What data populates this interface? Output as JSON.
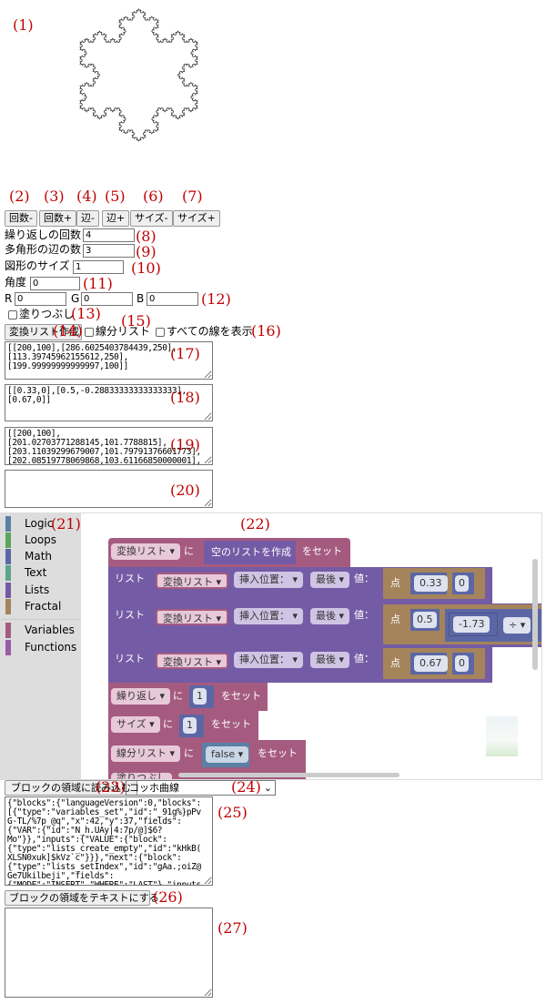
{
  "annotations": [
    "(1)",
    "(2)",
    "(3)",
    "(4)",
    "(5)",
    "(6)",
    "(7)",
    "(8)",
    "(9)",
    "(10)",
    "(11)",
    "(12)",
    "(13)",
    "(14)",
    "(15)",
    "(16)",
    "(17)",
    "(18)",
    "(19)",
    "(20)",
    "(21)",
    "(22)",
    "(23)",
    "(24)",
    "(25)",
    "(26)",
    "(27)"
  ],
  "fractal": {
    "type": "koch-snowflake",
    "stroke": "#333333",
    "iterations": 4,
    "sides": 3
  },
  "buttons": {
    "count_minus": "回数-",
    "count_plus": "回数+",
    "side_minus": "辺-",
    "side_plus": "辺+",
    "size_minus": "サイズ-",
    "size_plus": "サイズ+",
    "make_list": "変換リスト作成",
    "load_blocks": "ブロックの領域に読み込む",
    "blocks_to_text": "ブロックの領域をテキストにする"
  },
  "fields": {
    "repeat_label": "繰り返しの回数",
    "repeat_value": "4",
    "sides_label": "多角形の辺の数",
    "sides_value": "3",
    "size_label": "図形のサイズ",
    "size_value": "1",
    "angle_label": "角度",
    "angle_value": "0",
    "r_label": "R",
    "r_value": "0",
    "g_label": "G",
    "g_value": "0",
    "b_label": "B",
    "b_value": "0",
    "fill_label": "塗りつぶし",
    "segment_label": "線分リスト",
    "show_all_label": "すべての線を表示"
  },
  "textareas": {
    "t17": "[[200,100],[286.6025403784439,250],\n[113.39745962155612,250],\n[199.99999999999997,100]]",
    "t18": "[[0.33,0],[0.5,-0.28833333333333333],\n[0.67,0]]",
    "t19": "[[200,100],\n[201.02703771288145,101.7788815],\n[203.11039299679007,101.79791376601773],\n[202.08519778069868,103.61166850000001],\n[204.16855306460727,103.63069...]",
    "t20": "",
    "t25": "{\"blocks\":{\"languageVersion\":0,\"blocks\":\n[{\"type\":\"variables_set\",\"id\":\"_91g%}pPv\nG-TL/%7p_@q\",\"x\":42,\"y\":37,\"fields\":\n{\"VAR\":{\"id\":\"N_h.UAy|4:7p/@]$6?\nMo\"}},\"inputs\":{\"VALUE\":{\"block\":\n{\"type\":\"lists_create_empty\",\"id\":\"kHkB(\nXLSN0xuk]$kVz`c\"}}},\"next\":{\"block\":\n{\"type\":\"lists_setIndex\",\"id\":\"gAa.;oiZ@\nGe7Ukilbeji\",\"fields\":\n{\"MODE\":\"INSERT\",\"WHERE\":\"LAST\"},\"inputs",
    "t27": ""
  },
  "select": {
    "value": "コッホ曲線"
  },
  "toolbox": [
    {
      "label": "Logic",
      "color": "#5b80a5"
    },
    {
      "label": "Loops",
      "color": "#5ba55b"
    },
    {
      "label": "Math",
      "color": "#5b67a5"
    },
    {
      "label": "Text",
      "color": "#5ba58c"
    },
    {
      "label": "Lists",
      "color": "#745ba5"
    },
    {
      "label": "Fractal",
      "color": "#a5845b"
    },
    {
      "label": "Variables",
      "color": "#a55b80"
    },
    {
      "label": "Functions",
      "color": "#995ba5"
    }
  ],
  "blocks": {
    "set1": {
      "var": "変換リスト",
      "to": "に",
      "value": "空のリストを作成",
      "set": "をセット"
    },
    "list_rows": [
      {
        "prefix": "リスト",
        "var": "変換リスト",
        "mode": "挿入位置：",
        "where": "最後",
        "value_label": "値：",
        "point": "点",
        "x": "0.33",
        "y": "0"
      },
      {
        "prefix": "リスト",
        "var": "変換リスト",
        "mode": "挿入位置：",
        "where": "最後",
        "value_label": "値：",
        "point": "点",
        "x": "0.5",
        "y": "-1.73",
        "op": "÷"
      },
      {
        "prefix": "リスト",
        "var": "変換リスト",
        "mode": "挿入位置：",
        "where": "最後",
        "value_label": "値：",
        "point": "点",
        "x": "0.67",
        "y": "0"
      }
    ],
    "set_repeat": {
      "var": "繰り返し",
      "to": "に",
      "value": "1",
      "set": "をセット"
    },
    "set_size": {
      "var": "サイズ",
      "to": "に",
      "value": "1",
      "set": "をセット"
    },
    "set_segment": {
      "var": "線分リスト",
      "to": "に",
      "value": "false",
      "set": "をセット"
    },
    "set_fill_partial": {
      "var": "塗りつぶし"
    }
  }
}
